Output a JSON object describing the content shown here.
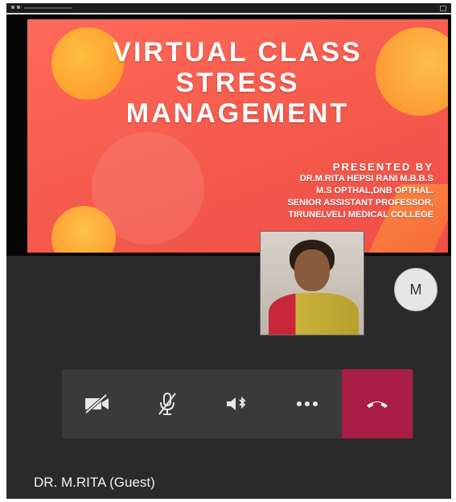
{
  "slide": {
    "title_lines": [
      "VIRTUAL CLASS",
      "STRESS",
      "MANAGEMENT"
    ],
    "presented_by": "PRESENTED BY",
    "presenter_lines": [
      "DR.M.RITA HEPSI RANI M.B.B.S",
      "M.S OPTHAL,DNB OPTHAL.",
      "SENIOR ASSISTANT PROFESSOR,",
      "TIRUNELVELI MEDICAL COLLEGE"
    ]
  },
  "participant": {
    "avatar_initial": "M",
    "name_label": "DR. M.RITA (Guest)"
  },
  "controls": [
    {
      "name": "camera-off",
      "icon": "video-off-icon"
    },
    {
      "name": "mic-off",
      "icon": "mic-off-icon"
    },
    {
      "name": "speaker",
      "icon": "speaker-bluetooth-icon"
    },
    {
      "name": "more",
      "icon": "more-options-icon",
      "label": "•••"
    },
    {
      "name": "hang-up",
      "icon": "hang-up-icon",
      "color": "#a81e46"
    }
  ]
}
